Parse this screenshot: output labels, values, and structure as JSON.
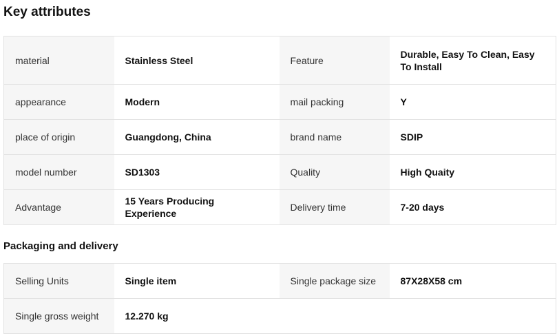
{
  "key_attributes": {
    "title": "Key attributes",
    "rows": [
      {
        "k1": "material",
        "v1": "Stainless Steel",
        "k2": "Feature",
        "v2": "Durable, Easy To Clean, Easy To Install"
      },
      {
        "k1": "appearance",
        "v1": "Modern",
        "k2": "mail packing",
        "v2": "Y"
      },
      {
        "k1": "place of origin",
        "v1": "Guangdong, China",
        "k2": "brand name",
        "v2": "SDIP"
      },
      {
        "k1": "model number",
        "v1": "SD1303",
        "k2": "Quality",
        "v2": "High Quaity"
      },
      {
        "k1": "Advantage",
        "v1": "15 Years Producing Experience",
        "k2": "Delivery time",
        "v2": "7-20 days"
      }
    ]
  },
  "packaging": {
    "title": "Packaging and delivery",
    "rows": [
      {
        "k1": "Selling Units",
        "v1": "Single item",
        "k2": "Single package size",
        "v2": "87X28X58 cm"
      },
      {
        "k1": "Single gross weight",
        "v1": "12.270 kg",
        "k2": "",
        "v2": ""
      }
    ]
  }
}
